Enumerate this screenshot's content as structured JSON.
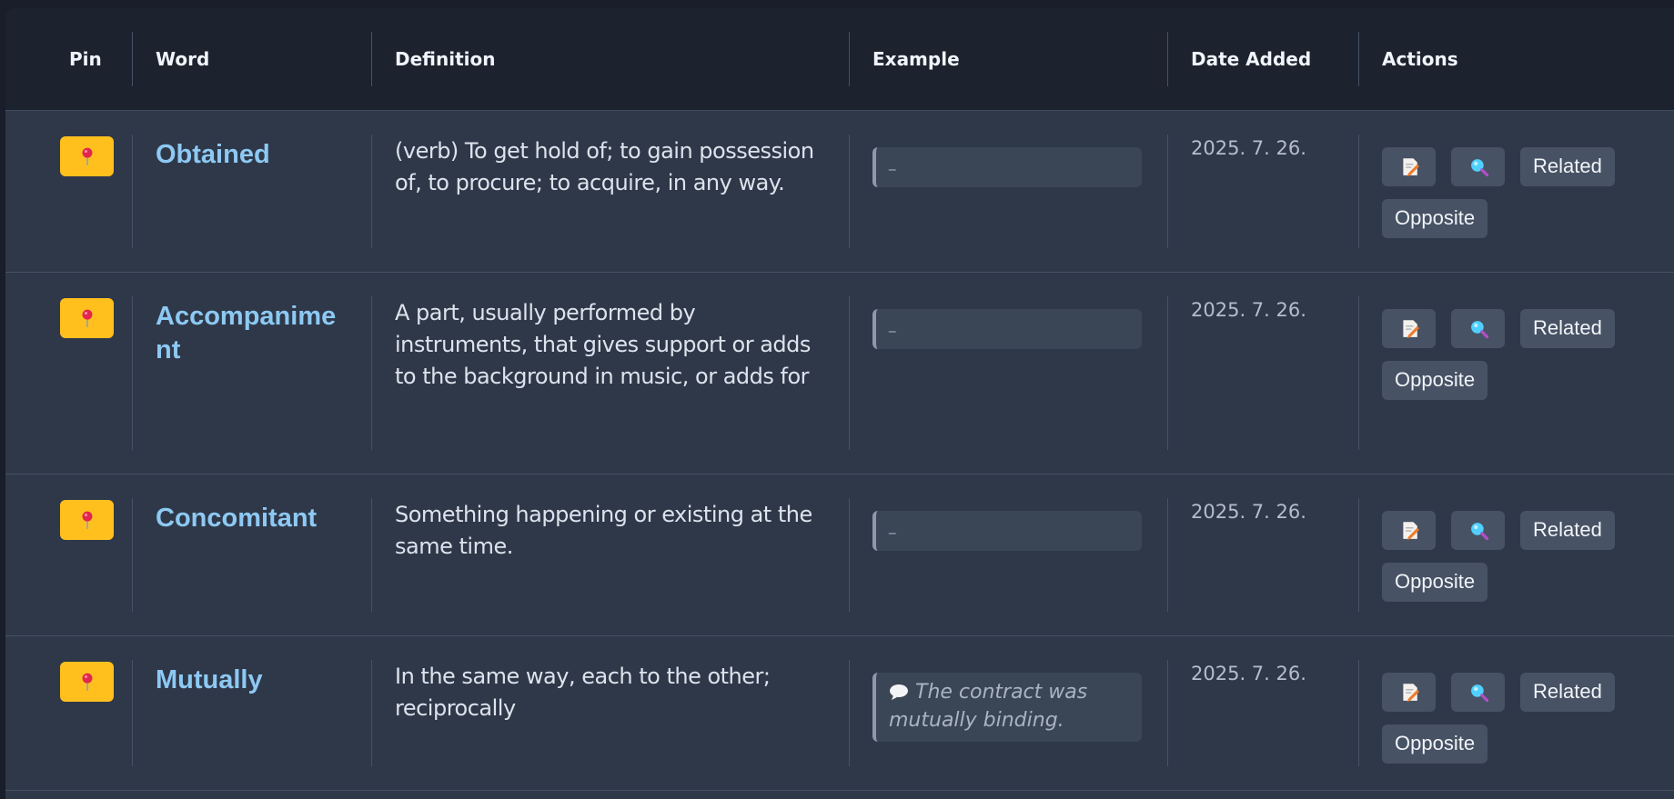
{
  "headers": {
    "pin": "Pin",
    "word": "Word",
    "definition": "Definition",
    "example": "Example",
    "date_added": "Date Added",
    "actions": "Actions"
  },
  "buttons": {
    "related": "Related",
    "opposite": "Opposite"
  },
  "icons": {
    "pin": "pushpin-icon",
    "edit": "memo-icon",
    "search": "magnifier-icon",
    "speech": "speech-bubble-icon"
  },
  "colors": {
    "pin_button": "#ffc01e",
    "word_link": "#8dc9f3",
    "row_bg": "#2f3849",
    "header_bg": "#1c222e"
  },
  "rows": [
    {
      "word": "Obtained",
      "definition": "(verb) To get hold of; to gain possession of, to procure; to acquire, in any way.",
      "example": "_",
      "date": "2025. 7. 26."
    },
    {
      "word": "Accompaniment",
      "definition": "A part, usually performed by instruments, that gives support or adds to the background in music, or adds for",
      "example": "_",
      "date": "2025. 7. 26."
    },
    {
      "word": "Concomitant",
      "definition": "Something happening or existing at the same time.",
      "example": "_",
      "date": "2025. 7. 26."
    },
    {
      "word": "Mutually",
      "definition": "In the same way, each to the other; reciprocally",
      "example": "The contract was mutually binding.",
      "date": "2025. 7. 26."
    }
  ]
}
